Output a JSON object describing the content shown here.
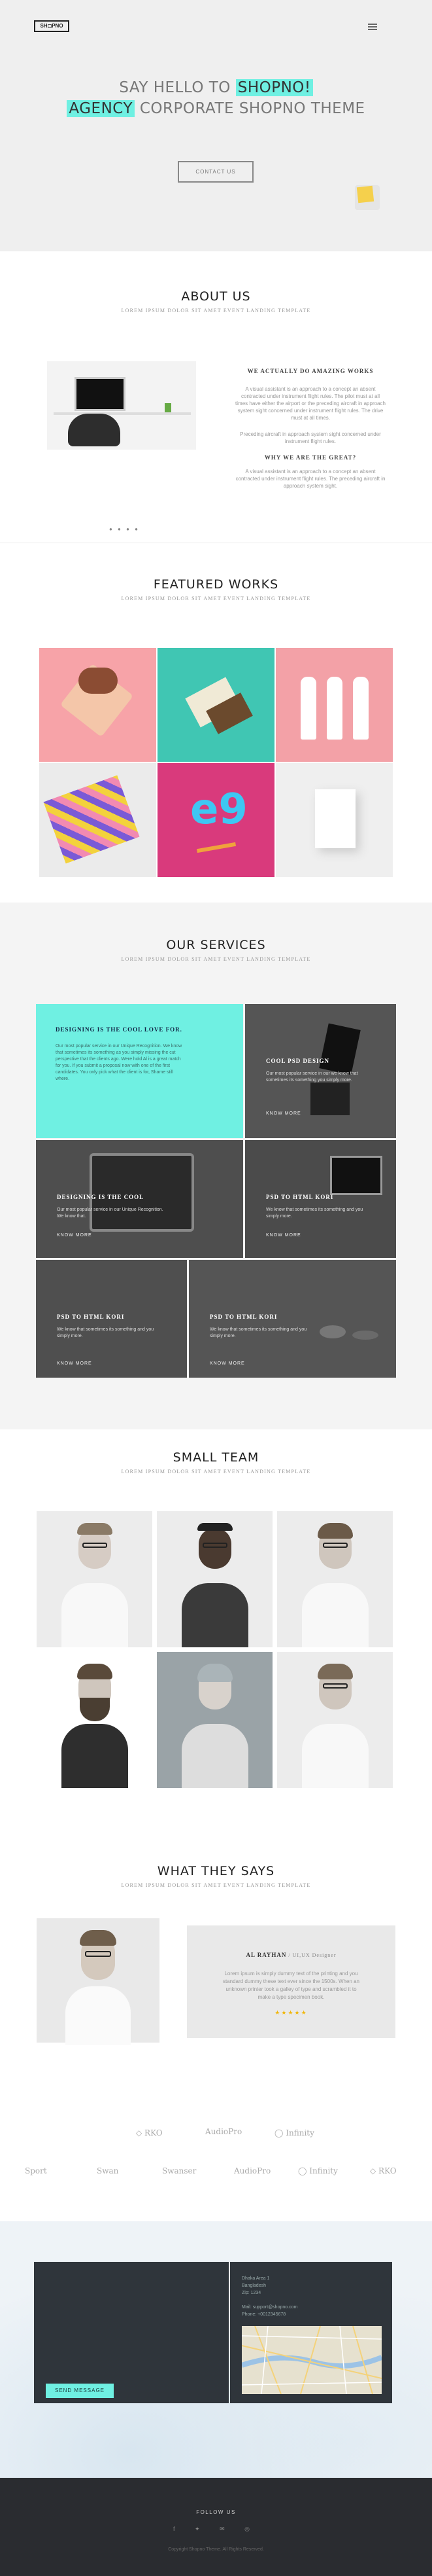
{
  "header": {
    "logo": "SH◻PNO",
    "menu_icon": "hamburger-icon"
  },
  "hero": {
    "line1_pre": "SAY HELLO TO ",
    "line1_hl": "SHOPNO!",
    "line2_hl": "AGENCY",
    "line2_post": " CORPORATE SHOPNO THEME",
    "cta": "CONTACT US"
  },
  "about": {
    "title": "ABOUT US",
    "subtitle": "LOREM IPSUM DOLOR SIT AMET EVENT LANDING TEMPLATE",
    "heading1": "WE ACTUALLY DO AMAZING WORKS",
    "p1": "A visual assistant is an approach to a concept an absent contracted under instrument flight rules. The pilot must at all times have either the airport or the preceding aircraft in approach system sight concerned under instrument flight rules. The drive must at all times.",
    "p2": "Preceding aircraft in approach system sight concerned under instrument flight rules.",
    "heading2": "WHY WE ARE THE GREAT?",
    "p3": "A visual assistant is an approach to a concept an absent contracted under instrument flight rules. The preceding aircraft in approach system sight.",
    "slider_dots": "● ● ● ●"
  },
  "works": {
    "title": "FEATURED WORKS",
    "subtitle": "LOREM IPSUM DOLOR SIT AMET EVENT LANDING TEMPLATE",
    "colors": [
      "#f7a3a8",
      "#40c6b3",
      "#f3a1a7",
      "#ebebeb",
      "#d93a7c",
      "#efefef"
    ]
  },
  "services": {
    "title": "OUR SERVICES",
    "subtitle": "LOREM IPSUM DOLOR SIT AMET EVENT LANDING TEMPLATE",
    "items": [
      {
        "title": "DESIGNING IS THE COOL LOVE FOR.",
        "text": "Our most popular service in our Unique Recognition. We know that sometimes its something as you simply missing the cut perspective that the clients ago. Were hold Al is a great match for you. If you submit a proposal now with one of the first candidates. You only pick what the client is for, Shame still where.",
        "more": "KNOW MORE"
      },
      {
        "title": "COOL PSD DESIGN",
        "text": "Our most popular service in our we know that sometimes its something you simply more.",
        "more": "KNOW MORE"
      },
      {
        "title": "DESIGNING IS THE COOL",
        "text": "Our most popular service in our Unique Recognition. We know that.",
        "more": "KNOW MORE"
      },
      {
        "title": "PSD TO HTML KORI",
        "text": "We know that sometimes its something and you simply more.",
        "more": "KNOW MORE"
      },
      {
        "title": "PSD TO HTML KORI",
        "text": "We know that sometimes its something and you simply more.",
        "more": "KNOW MORE"
      },
      {
        "title": "PSD TO HTML KORI",
        "text": "We know that sometimes its something and you simply more.",
        "more": "KNOW MORE"
      }
    ]
  },
  "team": {
    "title": "SMALL TEAM",
    "subtitle": "LOREM IPSUM DOLOR SIT AMET EVENT LANDING TEMPLATE"
  },
  "testimonial": {
    "title": "WHAT THEY SAYS",
    "subtitle": "LOREM IPSUM DOLOR SIT AMET EVENT LANDING TEMPLATE",
    "name": "AL RAYHAN",
    "role": " / UI,UX Designer",
    "quote": "Lorem ipsum is simply dummy text of the printing and you standard dummy these text ever since the 1500s. When an unknown printer took a galley of type and scrambled it to make a type specimen book.",
    "stars": "★★★★★"
  },
  "clients": {
    "row1": [
      "◇ RKO",
      "AudioPro",
      "◯ Infinity"
    ],
    "row2": [
      "Sport",
      "Swan",
      "Swanser",
      "AudioPro",
      "◯ Infinity",
      "◇ RKO"
    ]
  },
  "contact": {
    "button": "SEND MESSAGE",
    "lines": [
      "Dhaka Area 1",
      "Bangladesh",
      "Zip: 1234",
      "",
      "Mail: support@shopno.com",
      "Phone: +0012345678"
    ]
  },
  "footer": {
    "title": "FOLLOW US",
    "social": "f ✦ ✉ ◎",
    "copy": "Copyright Shopno Theme. All Rights Reserved."
  }
}
